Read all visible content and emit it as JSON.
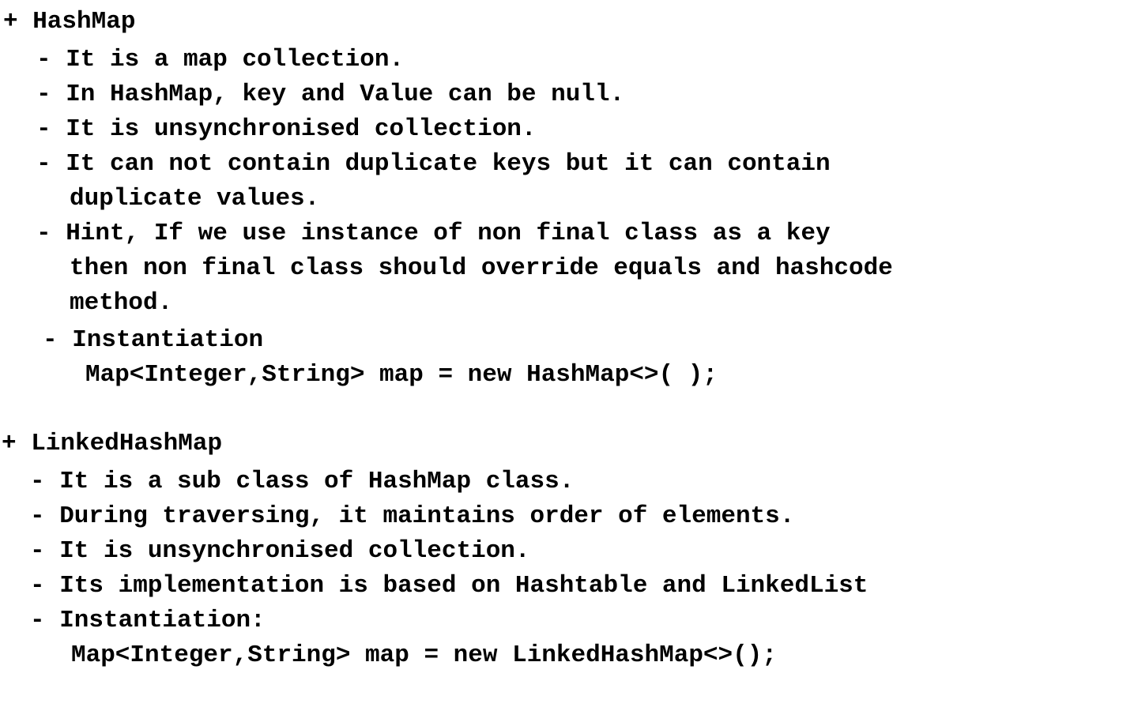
{
  "hashmap": {
    "heading": "+ HashMap",
    "points": [
      "- It is a map collection.",
      "- In HashMap, key and Value can be null.",
      "- It is unsynchronised collection.",
      "- It can not contain duplicate keys but it can contain",
      "duplicate values.",
      "- Hint, If we use instance of non final class as a key",
      "then non final class should override equals and hashcode",
      "method."
    ],
    "instantiation_label": "- Instantiation",
    "instantiation_code": "Map<Integer,String> map = new HashMap<>( );"
  },
  "linkedhashmap": {
    "heading": "+ LinkedHashMap",
    "points": [
      "- It is a sub class of HashMap class.",
      "- During traversing, it maintains order of elements.",
      "- It is unsynchronised collection.",
      "- Its implementation is based on Hashtable and LinkedList"
    ],
    "instantiation_label": "- Instantiation:",
    "instantiation_code": "Map<Integer,String> map = new LinkedHashMap<>();"
  }
}
